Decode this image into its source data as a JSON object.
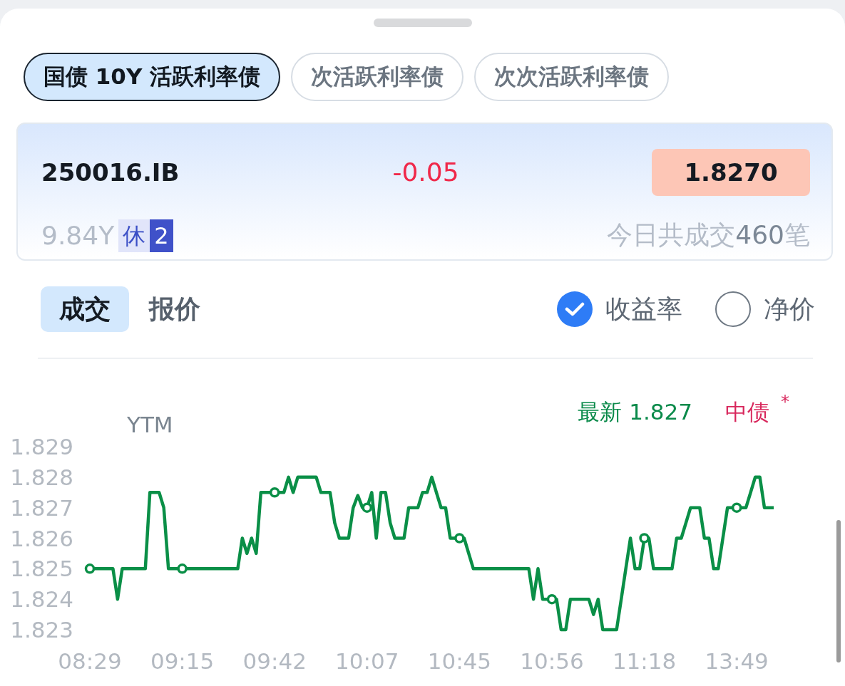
{
  "tabs": [
    {
      "label": "国债 10Y 活跃利率债",
      "selected": true
    },
    {
      "label": "次活跃利率债",
      "selected": false
    },
    {
      "label": "次次活跃利率债",
      "selected": false
    }
  ],
  "bond": {
    "code": "250016.IB",
    "change": "-0.05",
    "price": "1.8270",
    "term": "9.84Y",
    "tags": [
      {
        "label": "休",
        "kind": "light"
      },
      {
        "label": "2",
        "kind": "dark"
      }
    ],
    "trades": {
      "prefix": "今日共成交",
      "count": "460",
      "suffix": "笔"
    }
  },
  "view_tabs": [
    {
      "label": "成交",
      "selected": true
    },
    {
      "label": "报价",
      "selected": false
    }
  ],
  "price_types": [
    {
      "label": "收益率",
      "selected": true
    },
    {
      "label": "净价",
      "selected": false
    }
  ],
  "chart": {
    "latest": "最新 1.827",
    "source": "中债",
    "source_mark": "*",
    "chart_data": {
      "type": "line",
      "ylabel": "YTM",
      "ylim": [
        1.823,
        1.829
      ],
      "categories": [
        "08:29",
        null,
        null,
        null,
        null,
        null,
        null,
        null,
        null,
        null,
        null,
        null,
        null,
        null,
        null,
        null,
        null,
        null,
        null,
        null,
        "09:15",
        null,
        null,
        null,
        null,
        null,
        null,
        null,
        null,
        null,
        null,
        null,
        null,
        null,
        null,
        null,
        null,
        null,
        null,
        null,
        "09:42",
        null,
        null,
        null,
        null,
        null,
        null,
        null,
        null,
        null,
        null,
        null,
        null,
        null,
        null,
        null,
        null,
        null,
        null,
        null,
        "10:07",
        null,
        null,
        null,
        null,
        null,
        null,
        null,
        null,
        null,
        null,
        null,
        null,
        null,
        null,
        null,
        null,
        null,
        null,
        null,
        "10:45",
        null,
        null,
        null,
        null,
        null,
        null,
        null,
        null,
        null,
        null,
        null,
        null,
        null,
        null,
        null,
        null,
        null,
        null,
        null,
        "10:56",
        null,
        null,
        null,
        null,
        null,
        null,
        null,
        null,
        null,
        null,
        null,
        null,
        null,
        null,
        null,
        null,
        null,
        null,
        null,
        "11:18",
        null,
        null,
        null,
        null,
        null,
        null,
        null,
        null,
        null,
        null,
        null,
        null,
        null,
        null,
        null,
        null,
        null,
        null,
        null,
        "13:49",
        null,
        null,
        null,
        null,
        null,
        null,
        null,
        null
      ],
      "yticks": [
        1.829,
        1.828,
        1.827,
        1.826,
        1.825,
        1.824,
        1.823
      ],
      "series": [
        {
          "color": "#0a8f47",
          "values": [
            1.825,
            1.825,
            1.825,
            1.825,
            1.825,
            1.825,
            1.824,
            1.825,
            1.825,
            1.825,
            1.825,
            1.825,
            1.825,
            1.8275,
            1.8275,
            1.8275,
            1.827,
            1.825,
            1.825,
            1.825,
            1.825,
            1.825,
            1.825,
            1.825,
            1.825,
            1.825,
            1.825,
            1.825,
            1.825,
            1.825,
            1.825,
            1.825,
            1.825,
            1.826,
            1.8255,
            1.826,
            1.8255,
            1.8275,
            1.8275,
            1.8275,
            1.8275,
            1.8275,
            1.8275,
            1.828,
            1.8275,
            1.828,
            1.828,
            1.828,
            1.828,
            1.828,
            1.8275,
            1.8275,
            1.8275,
            1.8265,
            1.826,
            1.826,
            1.826,
            1.827,
            1.8274,
            1.827,
            1.827,
            1.8275,
            1.826,
            1.8275,
            1.8275,
            1.8265,
            1.826,
            1.826,
            1.826,
            1.827,
            1.827,
            1.827,
            1.8275,
            1.8275,
            1.828,
            1.8275,
            1.827,
            1.827,
            1.826,
            1.826,
            1.826,
            1.826,
            1.8255,
            1.825,
            1.825,
            1.825,
            1.825,
            1.825,
            1.825,
            1.825,
            1.825,
            1.825,
            1.825,
            1.825,
            1.825,
            1.825,
            1.824,
            1.825,
            1.824,
            1.824,
            1.824,
            1.824,
            1.823,
            1.823,
            1.824,
            1.824,
            1.824,
            1.824,
            1.824,
            1.8235,
            1.824,
            1.823,
            1.823,
            1.823,
            1.823,
            1.824,
            1.825,
            1.826,
            1.825,
            1.825,
            1.826,
            1.826,
            1.825,
            1.825,
            1.825,
            1.825,
            1.825,
            1.826,
            1.826,
            1.8265,
            1.827,
            1.827,
            1.827,
            1.826,
            1.826,
            1.825,
            1.825,
            1.826,
            1.827,
            1.827,
            1.827,
            1.827,
            1.827,
            1.8275,
            1.828,
            1.828,
            1.827,
            1.827,
            1.827
          ]
        }
      ]
    }
  }
}
